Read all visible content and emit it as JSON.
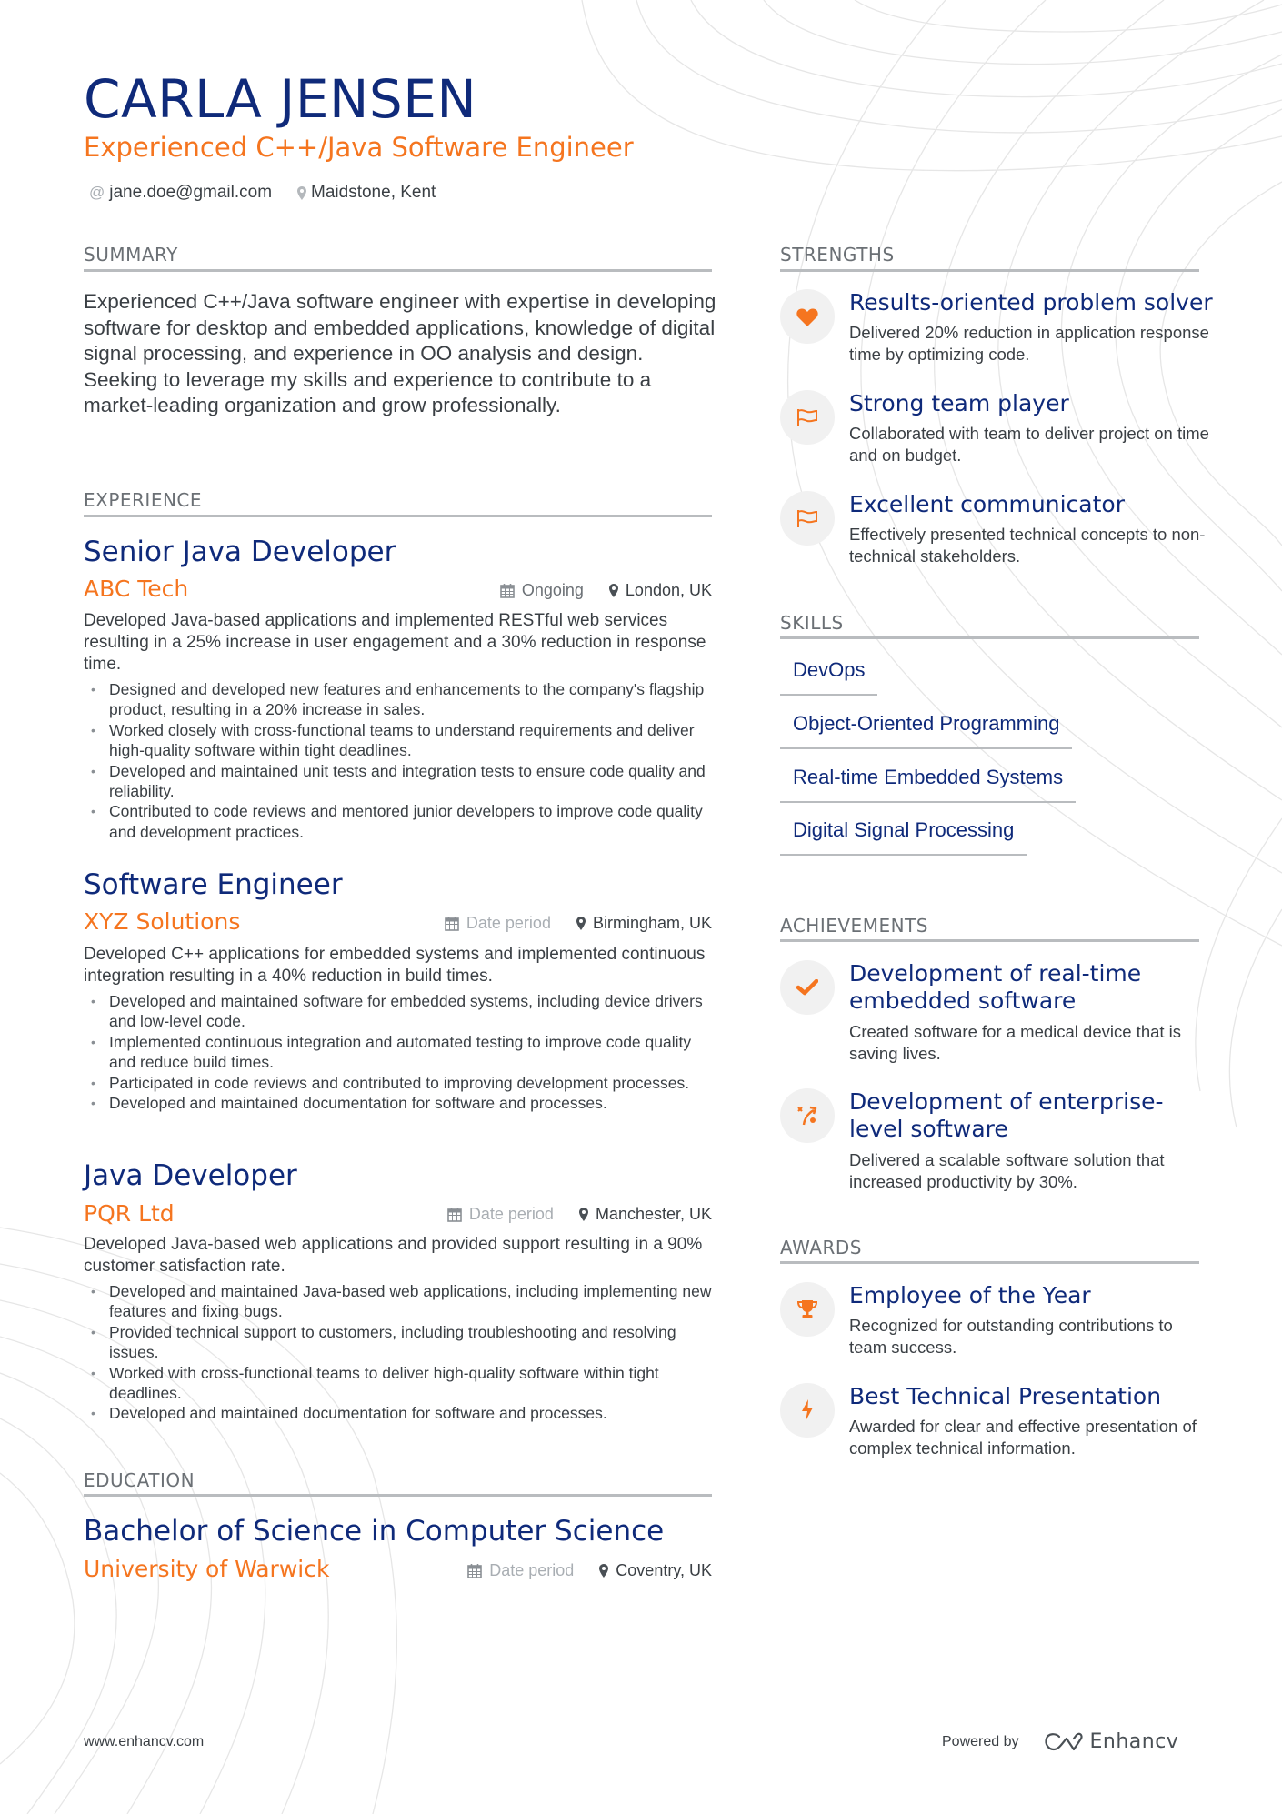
{
  "colors": {
    "navy": "#0f2a7a",
    "orange": "#f5751f",
    "text": "#3a3f44",
    "muted": "#a9aeb3",
    "rule": "#b9bcbf",
    "icon_bg": "#f1f1f1"
  },
  "header": {
    "name": "CARLA JENSEN",
    "title": "Experienced C++/Java Software Engineer",
    "email": "jane.doe@gmail.com",
    "email_icon": "at-icon",
    "location": "Maidstone, Kent",
    "location_icon": "map-pin-icon"
  },
  "summary": {
    "heading": "SUMMARY",
    "text": "Experienced C++/Java software engineer with expertise in developing software for desktop and embedded applications, knowledge of digital signal processing, and experience in OO analysis and design. Seeking to leverage my skills and experience to contribute to a market-leading organization and grow professionally."
  },
  "experience": {
    "heading": "EXPERIENCE",
    "jobs": [
      {
        "role": "Senior Java Developer",
        "company": "ABC Tech",
        "date": "Ongoing",
        "location": "London, UK",
        "description": "Developed Java-based applications and implemented RESTful web services resulting in a 25% increase in user engagement and a 30% reduction in response time.",
        "bullets": [
          "Designed and developed new features and enhancements to the company's flagship product, resulting in a 20% increase in sales.",
          "Worked closely with cross-functional teams to understand requirements and deliver high-quality software within tight deadlines.",
          "Developed and maintained unit tests and integration tests to ensure code quality and reliability.",
          "Contributed to code reviews and mentored junior developers to improve code quality and development practices."
        ]
      },
      {
        "role": "Software Engineer",
        "company": "XYZ Solutions",
        "date": "Date period",
        "location": "Birmingham, UK",
        "description": "Developed C++ applications for embedded systems and implemented continuous integration resulting in a 40% reduction in build times.",
        "bullets": [
          "Developed and maintained software for embedded systems, including device drivers and low-level code.",
          "Implemented continuous integration and automated testing to improve code quality and reduce build times.",
          "Participated in code reviews and contributed to improving development processes.",
          "Developed and maintained documentation for software and processes."
        ]
      },
      {
        "role": "Java Developer",
        "company": "PQR Ltd",
        "date": "Date period",
        "location": "Manchester, UK",
        "description": "Developed Java-based web applications and provided support resulting in a 90% customer satisfaction rate.",
        "bullets": [
          "Developed and maintained Java-based web applications, including implementing new features and fixing bugs.",
          "Provided technical support to customers, including troubleshooting and resolving issues.",
          "Worked with cross-functional teams to deliver high-quality software within tight deadlines.",
          "Developed and maintained documentation for software and processes."
        ]
      }
    ]
  },
  "education": {
    "heading": "EDUCATION",
    "items": [
      {
        "degree": "Bachelor of Science in Computer Science",
        "school": "University of Warwick",
        "date": "Date period",
        "location": "Coventry, UK"
      }
    ]
  },
  "strengths": {
    "heading": "STRENGTHS",
    "items": [
      {
        "icon": "heart-icon",
        "title": "Results-oriented problem solver",
        "description": "Delivered 20% reduction in application response time by optimizing code."
      },
      {
        "icon": "flag-icon",
        "title": "Strong team player",
        "description": "Collaborated with team to deliver project on time and on budget."
      },
      {
        "icon": "flag-icon",
        "title": "Excellent communicator",
        "description": "Effectively presented technical concepts to non-technical stakeholders."
      }
    ]
  },
  "skills": {
    "heading": "SKILLS",
    "items": [
      "DevOps",
      "Object-Oriented Programming",
      "Real-time Embedded Systems",
      "Digital Signal Processing"
    ]
  },
  "achievements": {
    "heading": "ACHIEVEMENTS",
    "items": [
      {
        "icon": "checkmark-icon",
        "title": "Development of real-time embedded software",
        "description": "Created software for a medical device that is saving lives."
      },
      {
        "icon": "strategy-icon",
        "title": "Development of enterprise-level software",
        "description": "Delivered a scalable software solution that increased productivity by 30%."
      }
    ]
  },
  "awards": {
    "heading": "AWARDS",
    "items": [
      {
        "icon": "trophy-icon",
        "title": "Employee of the Year",
        "description": "Recognized for outstanding contributions to team success."
      },
      {
        "icon": "lightning-icon",
        "title": "Best Technical Presentation",
        "description": "Awarded for clear and effective presentation of complex technical information."
      }
    ]
  },
  "footer": {
    "website": "www.enhancv.com",
    "powered_by": "Powered by",
    "brand": "Enhancv",
    "brand_icon": "enhancv-logo-icon"
  }
}
